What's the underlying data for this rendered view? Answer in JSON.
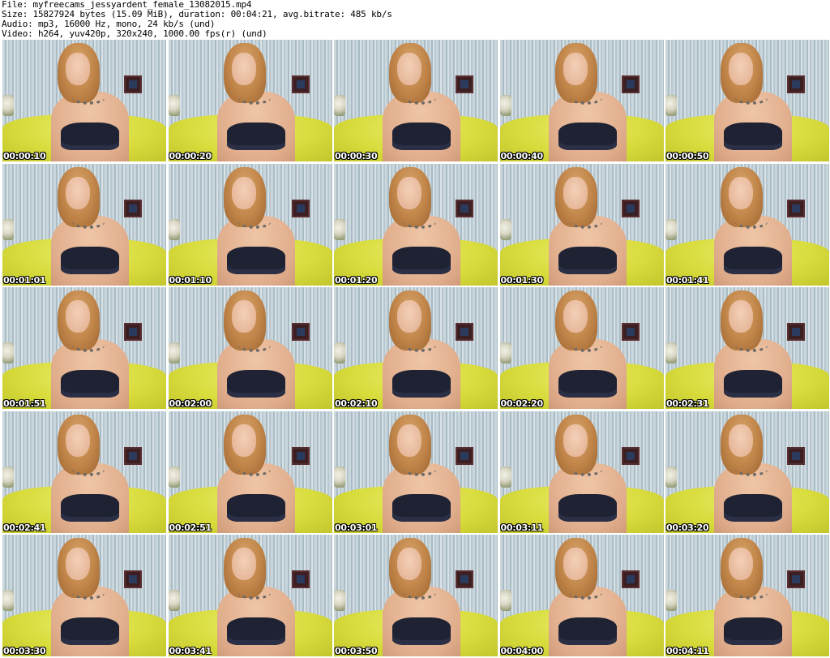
{
  "header": {
    "file_line": "File: myfreecams_jessyardent_female_13082015.mp4",
    "size_line": "Size: 15827924 bytes (15.09 MiB), duration: 00:04:21, avg.bitrate: 485 kb/s",
    "audio_line": "Audio: mp3, 16000 Hz, mono, 24 kb/s (und)",
    "video_line": "Video: h264, yuv420p, 320x240, 1000.00 fps(r) (und)"
  },
  "thumbnails": [
    {
      "timestamp": "00:00:10"
    },
    {
      "timestamp": "00:00:20"
    },
    {
      "timestamp": "00:00:30"
    },
    {
      "timestamp": "00:00:40"
    },
    {
      "timestamp": "00:00:50"
    },
    {
      "timestamp": "00:01:01"
    },
    {
      "timestamp": "00:01:10"
    },
    {
      "timestamp": "00:01:20"
    },
    {
      "timestamp": "00:01:30"
    },
    {
      "timestamp": "00:01:41"
    },
    {
      "timestamp": "00:01:51"
    },
    {
      "timestamp": "00:02:00"
    },
    {
      "timestamp": "00:02:10"
    },
    {
      "timestamp": "00:02:20"
    },
    {
      "timestamp": "00:02:31"
    },
    {
      "timestamp": "00:02:41"
    },
    {
      "timestamp": "00:02:51"
    },
    {
      "timestamp": "00:03:01"
    },
    {
      "timestamp": "00:03:11"
    },
    {
      "timestamp": "00:03:20"
    },
    {
      "timestamp": "00:03:30"
    },
    {
      "timestamp": "00:03:41"
    },
    {
      "timestamp": "00:03:50"
    },
    {
      "timestamp": "00:04:00"
    },
    {
      "timestamp": "00:04:11"
    }
  ]
}
